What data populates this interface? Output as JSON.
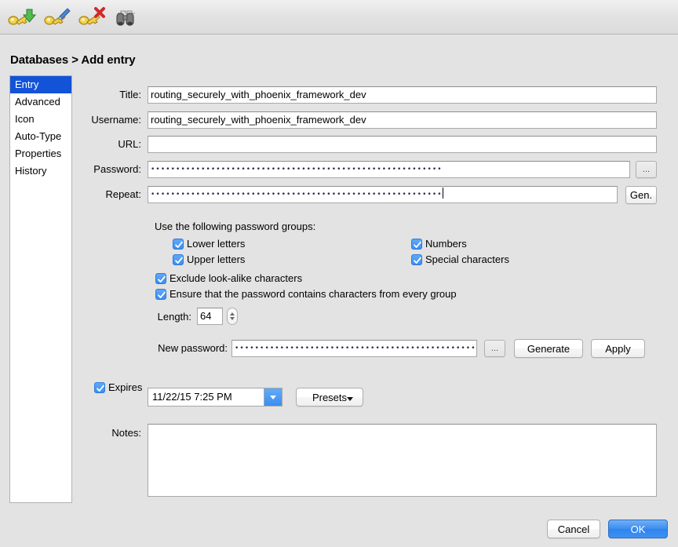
{
  "window": {
    "title": "Databases > Add entry"
  },
  "toolbar": {
    "items": [
      {
        "name": "add-entry-icon",
        "tooltip": "Add entry"
      },
      {
        "name": "edit-entry-icon",
        "tooltip": "Edit entry"
      },
      {
        "name": "delete-entry-icon",
        "tooltip": "Delete entry"
      },
      {
        "name": "search-icon",
        "tooltip": "Search"
      }
    ]
  },
  "sidebar": {
    "items": [
      {
        "label": "Entry",
        "selected": true
      },
      {
        "label": "Advanced",
        "selected": false
      },
      {
        "label": "Icon",
        "selected": false
      },
      {
        "label": "Auto-Type",
        "selected": false
      },
      {
        "label": "Properties",
        "selected": false
      },
      {
        "label": "History",
        "selected": false
      }
    ],
    "selected_color": "#1353d8"
  },
  "form": {
    "title_label": "Title:",
    "title_value": "routing_securely_with_phoenix_framework_dev",
    "username_label": "Username:",
    "username_value": "routing_securely_with_phoenix_framework_dev",
    "url_label": "URL:",
    "url_value": "",
    "password_label": "Password:",
    "password_value": "••••••••••••••••••••••••••••••••••••••••••••••••••••••••••",
    "password_browse_label": "...",
    "repeat_label": "Repeat:",
    "repeat_value": "••••••••••••••••••••••••••••••••••••••••••••••••••••••••••",
    "generate_short_label": "Gen.",
    "notes_label": "Notes:",
    "notes_value": ""
  },
  "generator": {
    "groups_caption": "Use the following password groups:",
    "checkboxes": [
      {
        "label": "Lower letters",
        "checked": true
      },
      {
        "label": "Upper letters",
        "checked": true
      },
      {
        "label": "Numbers",
        "checked": true
      },
      {
        "label": "Special characters",
        "checked": true
      }
    ],
    "exclude_lookalike_label": "Exclude look-alike characters",
    "exclude_lookalike_checked": true,
    "ensure_every_group_label": "Ensure that the password contains characters from every group",
    "ensure_every_group_checked": true,
    "length_label": "Length:",
    "length_value": "64",
    "new_password_label": "New password:",
    "new_password_value": "•••••••••••••••••••••••••••••••••••••••••••••••••••••••••••••••",
    "new_password_browse_label": "...",
    "generate_label": "Generate",
    "apply_label": "Apply"
  },
  "expiry": {
    "expires_label": "Expires",
    "expires_checked": true,
    "date_value": "11/22/15 7:25 PM",
    "presets_label": "Presets"
  },
  "footer": {
    "cancel_label": "Cancel",
    "ok_label": "OK",
    "default_button_color": "#3d8ff0"
  }
}
